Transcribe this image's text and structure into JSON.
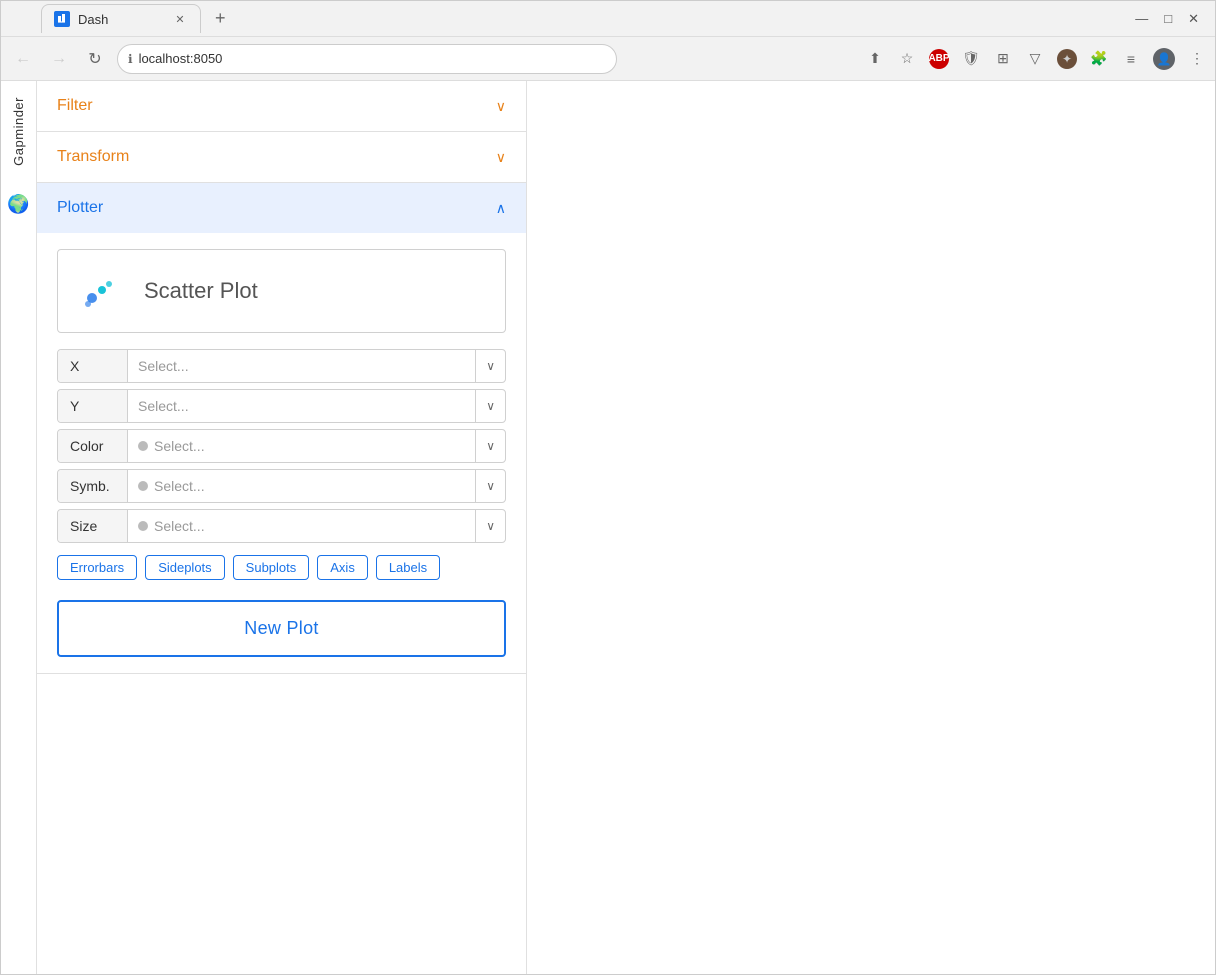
{
  "browser": {
    "tab_title": "Dash",
    "url": "localhost:8050",
    "new_tab_label": "+",
    "window_controls": [
      "—",
      "□",
      "✕"
    ]
  },
  "sidebar": {
    "label": "Gapminder",
    "globe_icon": "🌍"
  },
  "accordion": {
    "filter": {
      "title": "Filter",
      "chevron": "∨",
      "open": false
    },
    "transform": {
      "title": "Transform",
      "chevron": "∨",
      "open": false
    },
    "plotter": {
      "title": "Plotter",
      "chevron": "∧",
      "open": true
    }
  },
  "plotter": {
    "plot_type": "Scatter Plot",
    "fields": [
      {
        "label": "X",
        "placeholder": "Select...",
        "has_dot": false
      },
      {
        "label": "Y",
        "placeholder": "Select...",
        "has_dot": false
      },
      {
        "label": "Color",
        "placeholder": "Select...",
        "has_dot": true
      },
      {
        "label": "Symb.",
        "placeholder": "Select...",
        "has_dot": true
      },
      {
        "label": "Size",
        "placeholder": "Select...",
        "has_dot": true
      }
    ],
    "options": [
      "Errorbars",
      "Sideplots",
      "Subplots",
      "Axis",
      "Labels"
    ],
    "new_plot_label": "New Plot"
  }
}
